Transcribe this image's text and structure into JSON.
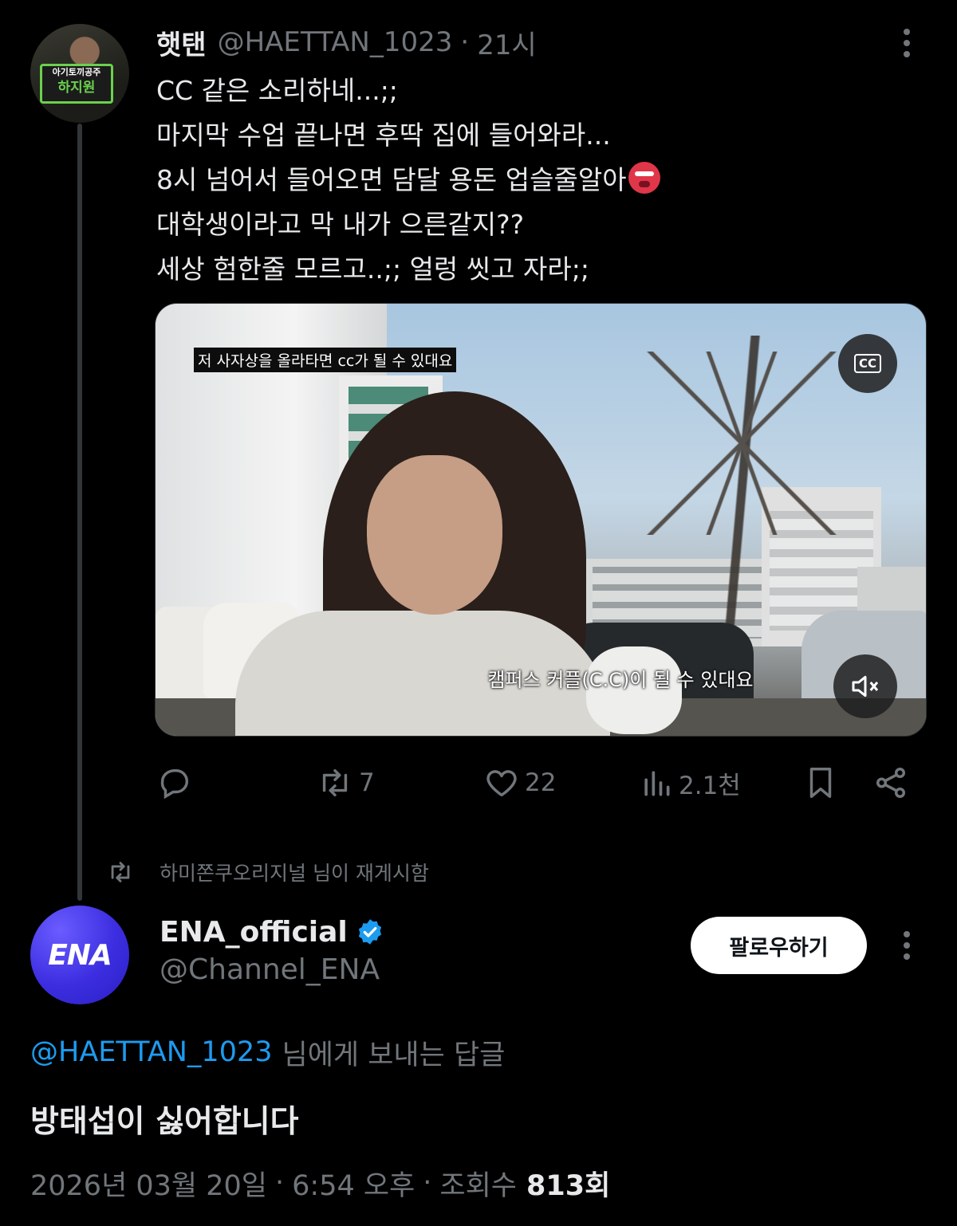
{
  "tweet1": {
    "display_name": "햇탠",
    "handle": "@HAETTAN_1023",
    "dot": "·",
    "time": "21시",
    "avatar_sign": [
      "아기토끼공주",
      "하지원"
    ],
    "lines": [
      "CC 같은 소리하네...;;",
      "마지막 수업 끝나면 후딱 집에 들어와라...",
      "8시 넘어서 들어오면 담달 용돈 업슬줄알아",
      "대학생이라고 막 내가 으른같지??",
      "세상 험한줄 모르고..;; 얼렁 씻고 자라;;"
    ],
    "emoji_icon": "angry-goblin-emoji",
    "video": {
      "subtitle_top": "저 사자상을 올라타면 cc가 될 수 있대요",
      "subtitle_bottom": "캠퍼스 커플(C.C)이 될 수 있대요",
      "cc_label": "CC",
      "mute_icon": "speaker-muted-icon"
    },
    "actions": {
      "reply_icon": "reply-icon",
      "retweet_icon": "retweet-icon",
      "retweet_count": "7",
      "like_icon": "heart-icon",
      "like_count": "22",
      "views_icon": "bar-chart-icon",
      "views_count": "2.1천",
      "bookmark_icon": "bookmark-icon",
      "share_icon": "share-icon"
    }
  },
  "retweet_note": {
    "icon": "retweet-icon",
    "text": "하미쫀쿠오리지널 님이 재게시함"
  },
  "tweet2": {
    "avatar_text": "ENA",
    "display_name": "ENA_official",
    "verified_icon": "verified-badge-icon",
    "handle": "@Channel_ENA",
    "follow_label": "팔로우하기",
    "reply_to_handle": "@HAETTAN_1023",
    "reply_to_suffix": "님에게 보내는 답글",
    "text": "방태섭이 싫어합니다",
    "date": "2026년 03월 20일",
    "sep1": "·",
    "time": "6:54 오후",
    "sep2": "·",
    "views_label": "조회수",
    "views_count": "813회"
  },
  "colors": {
    "background": "#000000",
    "text_primary": "#e7e9ea",
    "text_secondary": "#71767b",
    "link": "#1d9bf0",
    "verified": "#1d9bf0",
    "ena_brand": "#3c2ee0"
  }
}
